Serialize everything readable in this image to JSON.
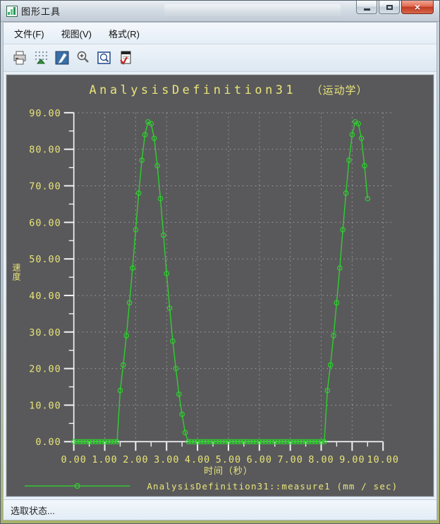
{
  "window": {
    "title": "图形工具",
    "controls": {
      "minimize": "minimize",
      "maximize": "maximize",
      "close": "close"
    }
  },
  "menu": {
    "items": [
      {
        "label": "文件(F)"
      },
      {
        "label": "视图(V)"
      },
      {
        "label": "格式(R)"
      }
    ]
  },
  "toolbar": {
    "icons": [
      "print-icon",
      "point-display-icon",
      "edit-graph-icon",
      "zoom-in-icon",
      "refit-icon",
      "graph-options-icon"
    ]
  },
  "status": {
    "text": "选取状态..."
  },
  "chart_data": {
    "type": "line",
    "title": "AnalysisDefinition31",
    "title_suffix": "（运动学）",
    "xlabel": "时间（秒）",
    "ylabel": "速度",
    "legend": "AnalysisDefinition31::measure1  (mm / sec)",
    "xlim": [
      0,
      10
    ],
    "ylim": [
      0,
      90
    ],
    "x_major": 1,
    "x_minor": 0.5,
    "y_major": 10,
    "y_minor": 5,
    "x_tick_labels": [
      "0.00",
      "1.00",
      "2.00",
      "3.00",
      "4.00",
      "5.00",
      "6.00",
      "7.00",
      "8.00",
      "9.00",
      "10.00"
    ],
    "y_tick_labels": [
      "0.00",
      "10.00",
      "20.00",
      "30.00",
      "40.00",
      "50.00",
      "60.00",
      "70.00",
      "80.00",
      "90.00"
    ],
    "grid": "dotted",
    "legend_position": "bottom",
    "colors": {
      "curve": "#2dd12d",
      "text": "#e9e578",
      "axis": "#f2f2f2",
      "grid": "#a2a2a4",
      "background": "#59595b"
    },
    "series": [
      {
        "name": "AnalysisDefinition31::measure1",
        "units": "mm / sec",
        "x_start": 0.0,
        "x_step": 0.1,
        "values": [
          0,
          0,
          0,
          0,
          0,
          0,
          0,
          0,
          0,
          0,
          0,
          0,
          0,
          0,
          0,
          14,
          21,
          29,
          38,
          47.5,
          58,
          68,
          77,
          84,
          87.5,
          87,
          83,
          75.5,
          66.5,
          56.5,
          46,
          36.5,
          27.5,
          20,
          13,
          7.5,
          2.5,
          0,
          0,
          0,
          0,
          0,
          0,
          0,
          0,
          0,
          0,
          0,
          0,
          0,
          0,
          0,
          0,
          0,
          0,
          0,
          0,
          0,
          0,
          0,
          0,
          0,
          0,
          0,
          0,
          0,
          0,
          0,
          0,
          0,
          0,
          0,
          0,
          0,
          0,
          0,
          0,
          0,
          0,
          0,
          0,
          0,
          14,
          21,
          29,
          38,
          47.5,
          58,
          68,
          77,
          84,
          87.5,
          87,
          83,
          75.5,
          66.5
        ]
      }
    ]
  }
}
